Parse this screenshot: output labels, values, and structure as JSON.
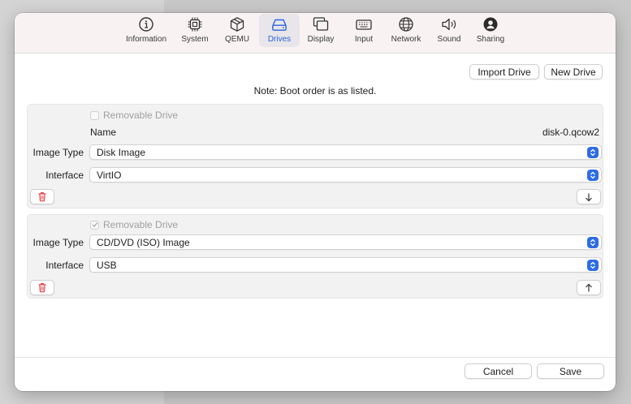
{
  "toolbar": {
    "tabs": [
      {
        "label": "Information",
        "icon": "info-icon"
      },
      {
        "label": "System",
        "icon": "cpu-icon"
      },
      {
        "label": "QEMU",
        "icon": "cube-icon"
      },
      {
        "label": "Drives",
        "icon": "drive-icon",
        "active": true
      },
      {
        "label": "Display",
        "icon": "display-icon"
      },
      {
        "label": "Input",
        "icon": "keyboard-icon"
      },
      {
        "label": "Network",
        "icon": "globe-icon"
      },
      {
        "label": "Sound",
        "icon": "speaker-icon"
      },
      {
        "label": "Sharing",
        "icon": "person-icon"
      }
    ]
  },
  "actions": {
    "import_drive": "Import Drive",
    "new_drive": "New Drive"
  },
  "note": "Note: Boot order is as listed.",
  "drives": [
    {
      "removable_label": "Removable Drive",
      "removable_checked": false,
      "name_label": "Name",
      "name_value": "disk-0.qcow2",
      "image_type_label": "Image Type",
      "image_type_value": "Disk Image",
      "interface_label": "Interface",
      "interface_value": "VirtIO",
      "move_icon": "arrow-down-icon"
    },
    {
      "removable_label": "Removable Drive",
      "removable_checked": true,
      "image_type_label": "Image Type",
      "image_type_value": "CD/DVD (ISO) Image",
      "interface_label": "Interface",
      "interface_value": "USB",
      "move_icon": "arrow-up-icon"
    }
  ],
  "footer": {
    "cancel": "Cancel",
    "save": "Save"
  },
  "colors": {
    "accent": "#2e6ce5",
    "delete_red": "#e5484d",
    "toolbar_bg": "#f8f3f2",
    "panel_bg": "#f2f2f2"
  }
}
